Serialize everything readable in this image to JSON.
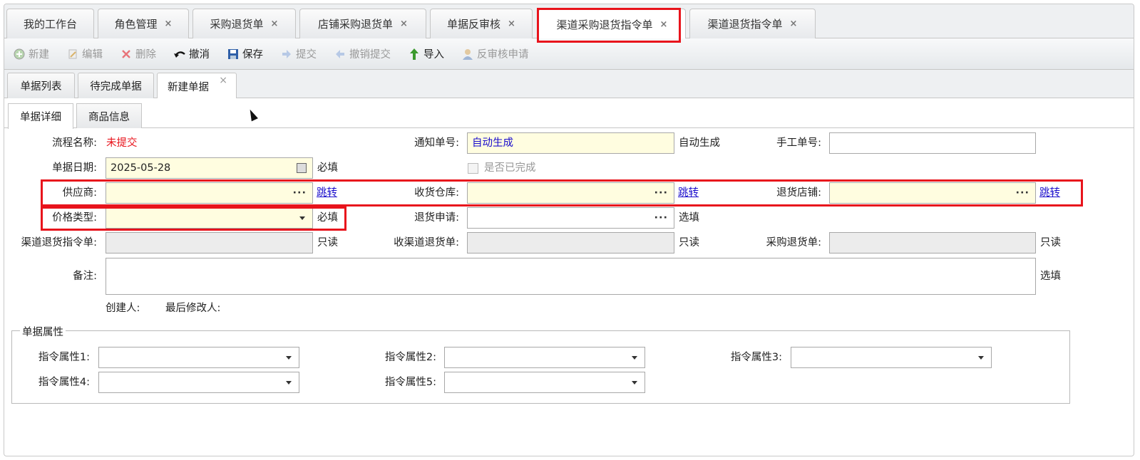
{
  "top_tabs": [
    {
      "label": "我的工作台",
      "closable": false
    },
    {
      "label": "角色管理",
      "closable": true
    },
    {
      "label": "采购退货单",
      "closable": true
    },
    {
      "label": "店铺采购退货单",
      "closable": true
    },
    {
      "label": "单据反审核",
      "closable": true
    },
    {
      "label": "渠道采购退货指令单",
      "closable": true,
      "active": true
    },
    {
      "label": "渠道退货指令单",
      "closable": true
    }
  ],
  "close_glyph": "×",
  "toolbar": {
    "new": "新建",
    "edit": "编辑",
    "delete": "删除",
    "undo": "撤消",
    "save": "保存",
    "submit": "提交",
    "cancel_submit": "撤销提交",
    "import": "导入",
    "reverse_audit": "反审核申请"
  },
  "sub_tabs": [
    "单据列表",
    "待完成单据",
    "新建单据"
  ],
  "inner_tabs": [
    "单据详细",
    "商品信息"
  ],
  "form": {
    "process_name_label": "流程名称:",
    "process_name_value": "未提交",
    "notice_no_label": "通知单号:",
    "notice_no_value": "自动生成",
    "notice_no_hint": "自动生成",
    "manual_no_label": "手工单号:",
    "manual_no_value": "",
    "date_label": "单据日期:",
    "date_value": "2025-05-28",
    "date_hint": "必填",
    "completed_label": "是否已完成",
    "supplier_label": "供应商:",
    "supplier_link": "跳转",
    "warehouse_label": "收货仓库:",
    "warehouse_link": "跳转",
    "return_store_label": "退货店铺:",
    "return_store_link": "跳转",
    "price_type_label": "价格类型:",
    "price_type_hint": "必填",
    "return_apply_label": "退货申请:",
    "return_apply_hint": "选填",
    "channel_return_label": "渠道退货指令单:",
    "channel_return_hint": "只读",
    "receive_channel_label": "收渠道退货单:",
    "receive_channel_hint": "只读",
    "purchase_return_label": "采购退货单:",
    "purchase_return_hint": "只读",
    "remark_label": "备注:",
    "remark_hint": "选填",
    "creator_label": "创建人:",
    "modifier_label": "最后修改人:"
  },
  "props": {
    "legend": "单据属性",
    "attr1": "指令属性1:",
    "attr2": "指令属性2:",
    "attr3": "指令属性3:",
    "attr4": "指令属性4:",
    "attr5": "指令属性5:"
  },
  "colors": {
    "highlight": "#e8141c",
    "link": "#1a0dcc",
    "required_bg": "#fffde0",
    "status_red": "#e8141c"
  }
}
